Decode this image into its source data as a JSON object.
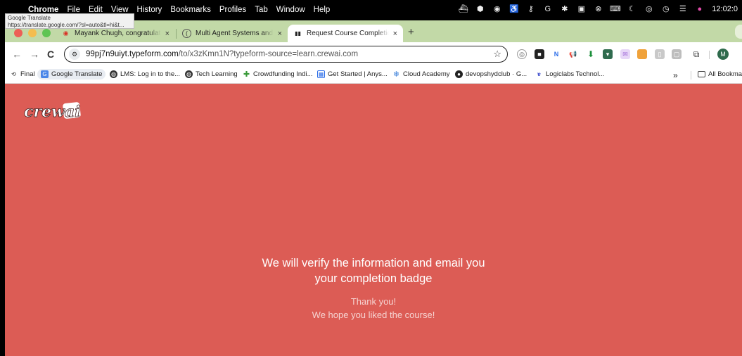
{
  "menubar": {
    "app": "Chrome",
    "menus": [
      "File",
      "Edit",
      "View",
      "History",
      "Bookmarks",
      "Profiles",
      "Tab",
      "Window",
      "Help"
    ],
    "clock": "12:02:0"
  },
  "tooltip": {
    "title": "Google Translate",
    "url": "https://translate.google.com/?sl=auto&tl=hi&t..."
  },
  "tabs": [
    {
      "title": "Mayank Chugh, congratulatio",
      "close": "×",
      "icon": "gmail-icon"
    },
    {
      "title": "Multi Agent Systems and how",
      "close": "×",
      "icon": "deeplearning-icon"
    },
    {
      "title": "Request Course Completion B",
      "close": "×",
      "icon": "typeform-icon",
      "active": true
    }
  ],
  "newtab": "+",
  "toolbar": {
    "back": "←",
    "forward": "→",
    "reload": "C",
    "url_host": "99pj7n9uiyt.typeform.com",
    "url_path": "/to/x3zKmn1N?typeform-source=learn.crewai.com",
    "avatar": "M"
  },
  "bookmarks": [
    {
      "label": "Final",
      "icon": "history-icon"
    },
    {
      "label": "Google Translate",
      "icon": "google-translate-icon"
    },
    {
      "label": "LMS: Log in to the...",
      "icon": "globe-icon"
    },
    {
      "label": "Tech Learning",
      "icon": "globe-icon"
    },
    {
      "label": "Crowdfunding Indi...",
      "icon": "crowdfunding-icon"
    },
    {
      "label": "Get Started | Anys...",
      "icon": "anysphere-icon"
    },
    {
      "label": "Cloud Academy",
      "icon": "cloud-academy-icon"
    },
    {
      "label": "devopshydclub · G...",
      "icon": "github-icon"
    },
    {
      "label": "Logiclabs Technol...",
      "icon": "logiclabs-icon"
    }
  ],
  "bookmarks_more": "»",
  "all_bookmarks": "All Bookmar",
  "page": {
    "logo_text": "crewai",
    "message_line1": "We will verify the information and email you",
    "message_line2": "your completion badge",
    "thanks_line1": "Thank you!",
    "thanks_line2": "We hope you liked the course!",
    "background_color": "#dc5c55"
  }
}
